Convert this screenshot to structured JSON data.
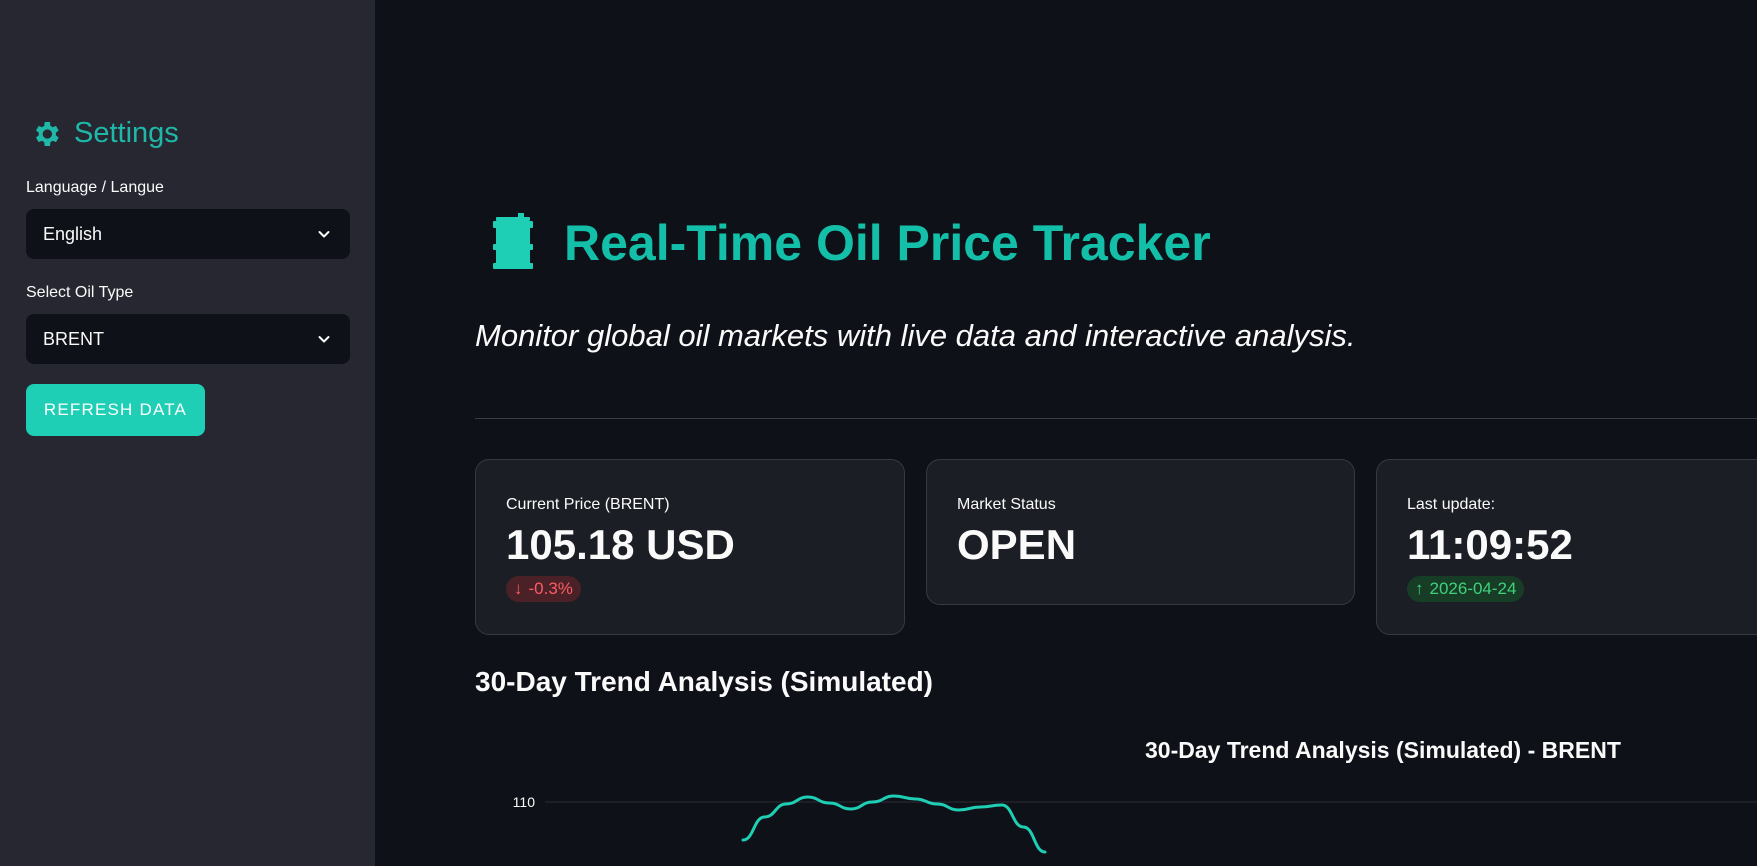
{
  "sidebar": {
    "title": "Settings",
    "language_label": "Language / Langue",
    "language_value": "English",
    "oil_type_label": "Select Oil Type",
    "oil_type_value": "BRENT",
    "refresh_label": "REFRESH DATA"
  },
  "header": {
    "title": "Real-Time Oil Price Tracker",
    "subtitle": "Monitor global oil markets with live data and interactive analysis."
  },
  "metrics": {
    "price": {
      "label": "Current Price (BRENT)",
      "value": "105.18 USD",
      "delta": "-0.3%",
      "arrow": "↓"
    },
    "status": {
      "label": "Market Status",
      "value": "OPEN"
    },
    "update": {
      "label": "Last update:",
      "value": "11:09:52",
      "delta": "2026-04-24",
      "arrow": "↑"
    }
  },
  "section_title": "30-Day Trend Analysis (Simulated)",
  "colors": {
    "accent": "#1fcfb5",
    "background": "#0e1117",
    "sidebar": "#262730",
    "negative": "#ff5b66",
    "positive": "#3fd27a"
  },
  "chart_data": {
    "type": "line",
    "title": "30-Day Trend Analysis (Simulated) - BRENT",
    "yticks": [
      110
    ],
    "ylim_visible_top": 111,
    "series": [
      {
        "color": "#1fcfb5",
        "values_visible": [
          106.2,
          108.5,
          109.8,
          110.5,
          109.9,
          109.3,
          110.0,
          110.6,
          110.3,
          109.8,
          109.2,
          109.5,
          109.7,
          107.5,
          105.0
        ]
      }
    ]
  }
}
